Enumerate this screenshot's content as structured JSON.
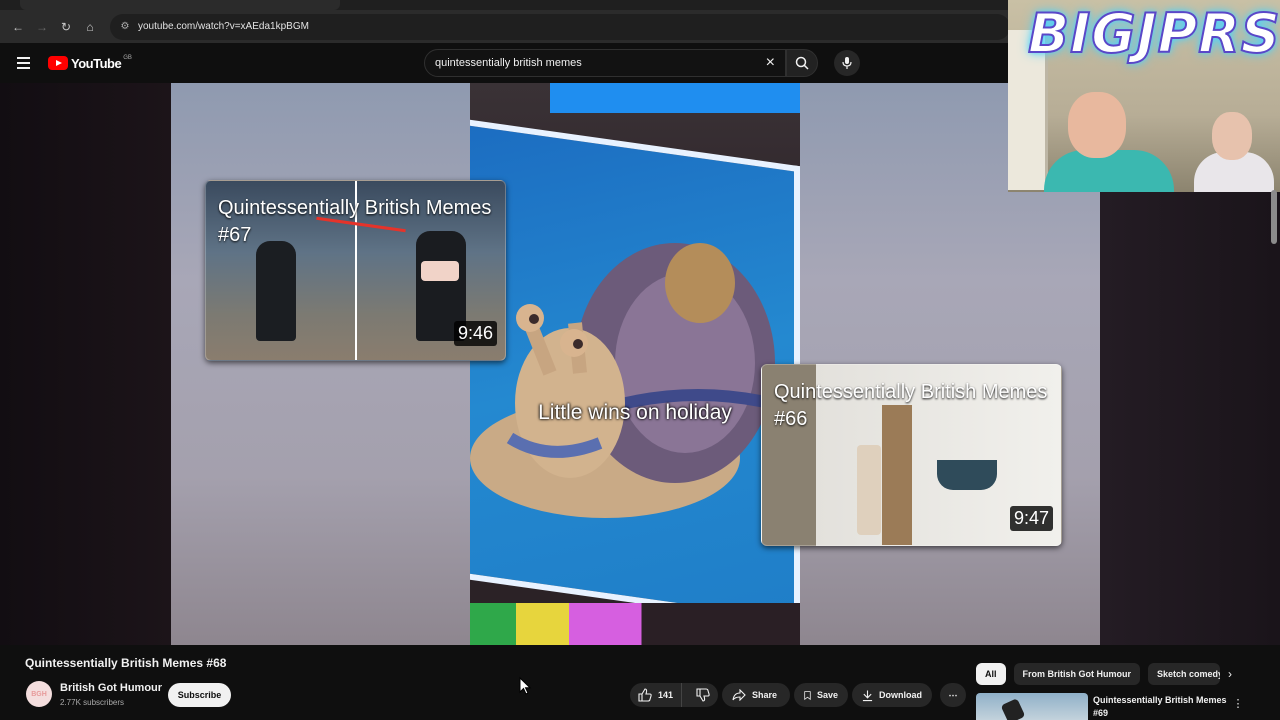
{
  "browser": {
    "url": "youtube.com/watch?v=xAEda1kpBGM"
  },
  "youtube": {
    "logo_text": "YouTube",
    "region": "GB",
    "search_value": "quintessentially british memes"
  },
  "video": {
    "caption": "Little wins on holiday",
    "endcards": [
      {
        "title": "Quintessentially British Memes #67",
        "duration": "9:46"
      },
      {
        "title": "Quintessentially British Memes #66",
        "duration": "9:47"
      }
    ]
  },
  "overlay": {
    "streamer_logo": "BIGJPRS"
  },
  "watch": {
    "title": "Quintessentially British Memes #68",
    "channel_name": "British Got Humour",
    "channel_avatar_text": "BGH",
    "subscribers": "2.77K subscribers",
    "subscribe_label": "Subscribe",
    "likes": "141",
    "share_label": "Share",
    "save_label": "Save",
    "download_label": "Download"
  },
  "sidebar": {
    "chips": [
      "All",
      "From British Got Humour",
      "Sketch comedy"
    ],
    "recommended": [
      {
        "title": "Quintessentially British Memes #69"
      }
    ]
  },
  "colors": {
    "youtube_red": "#ff0000",
    "background": "#0f0f0f",
    "chip_bg": "#272727"
  }
}
